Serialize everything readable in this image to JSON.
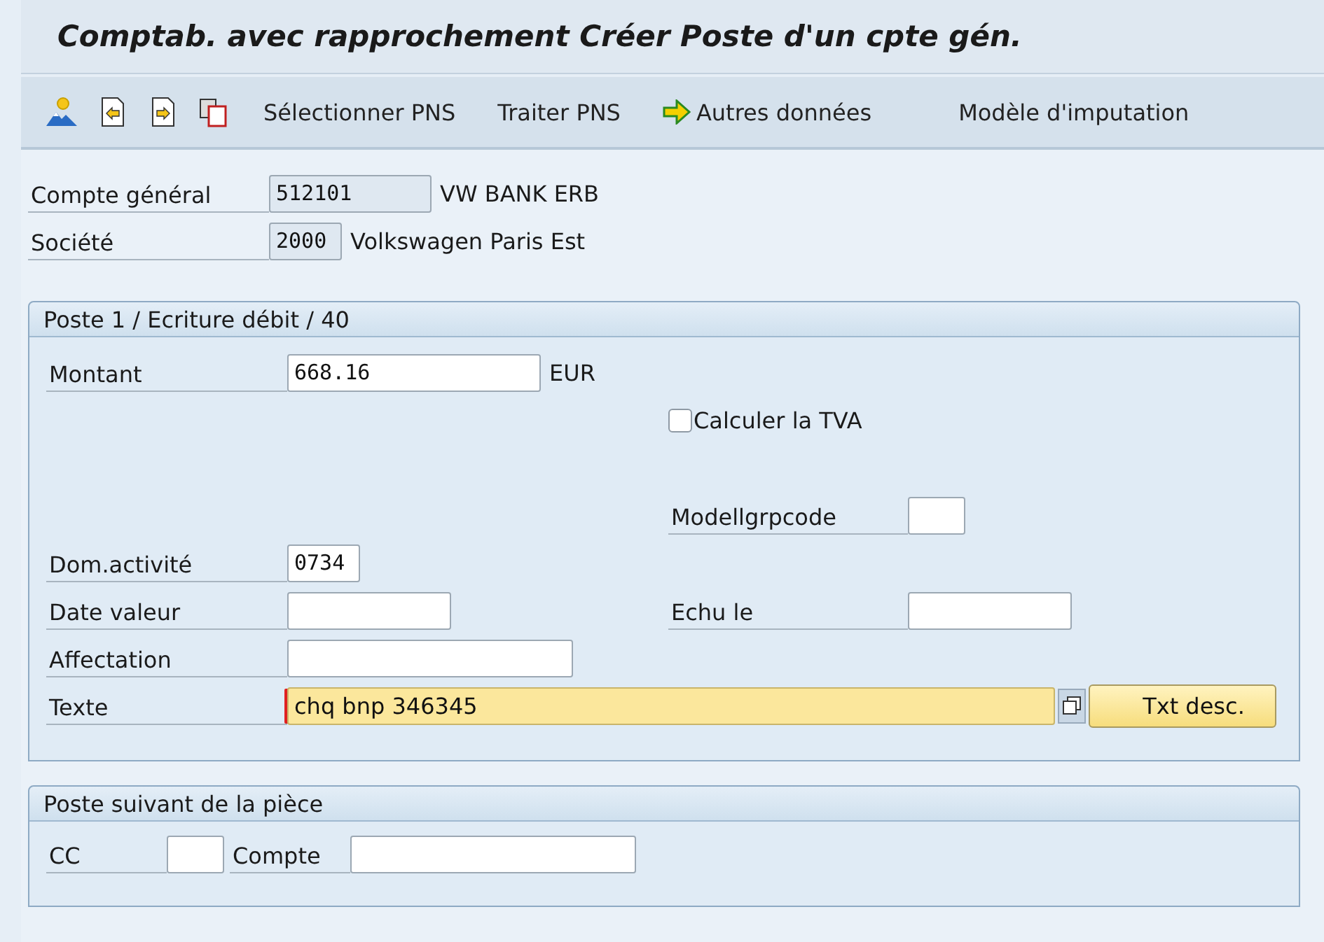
{
  "window": {
    "title": "Comptab. avec rapprochement Créer Poste d'un cpte gén."
  },
  "toolbar": {
    "buttons": [
      {
        "label": "Sélectionner PNS",
        "has_icon": false
      },
      {
        "label": "Traiter PNS",
        "has_icon": false
      },
      {
        "label": "Autres données",
        "has_icon": true
      },
      {
        "label": "Modèle d'imputation",
        "has_icon": false
      }
    ]
  },
  "header": {
    "fields": [
      {
        "label": "Compte général",
        "value": "512101",
        "kind": "account",
        "description": "VW BANK ERB"
      },
      {
        "label": "Société",
        "value": "2000",
        "kind": "code4",
        "description": "Volkswagen Paris Est"
      }
    ]
  },
  "item_section": {
    "title": "Poste 1 / Ecriture débit / 40",
    "rows": [
      {
        "kind": "field",
        "left": {
          "label": "Montant",
          "value": "668.16",
          "kind": "amount",
          "unit": "EUR"
        }
      },
      {
        "kind": "checkbox",
        "label": "Calculer la TVA",
        "checked": false
      },
      {
        "kind": "field",
        "right": {
          "label": "Modellgrpcode",
          "kind": "code2"
        }
      },
      {
        "kind": "field",
        "left": {
          "label": "Dom.activité",
          "value": "0734",
          "kind": "code4"
        }
      },
      {
        "kind": "field",
        "left": {
          "label": "Date valeur",
          "kind": "date"
        },
        "right": {
          "label": "Echu le",
          "kind": "date"
        }
      },
      {
        "kind": "field",
        "left": {
          "label": "Affectation",
          "kind": "assignment"
        }
      },
      {
        "kind": "field",
        "left": {
          "label": "Texte",
          "value": "chq bnp 346345",
          "kind": "text",
          "focused": true
        },
        "button": "Txt desc."
      }
    ]
  },
  "next_section": {
    "title": "Poste suivant de la pièce",
    "fields": [
      {
        "label": "CC",
        "kind": "code2"
      },
      {
        "label": "Compte",
        "kind": "assignment"
      }
    ]
  }
}
